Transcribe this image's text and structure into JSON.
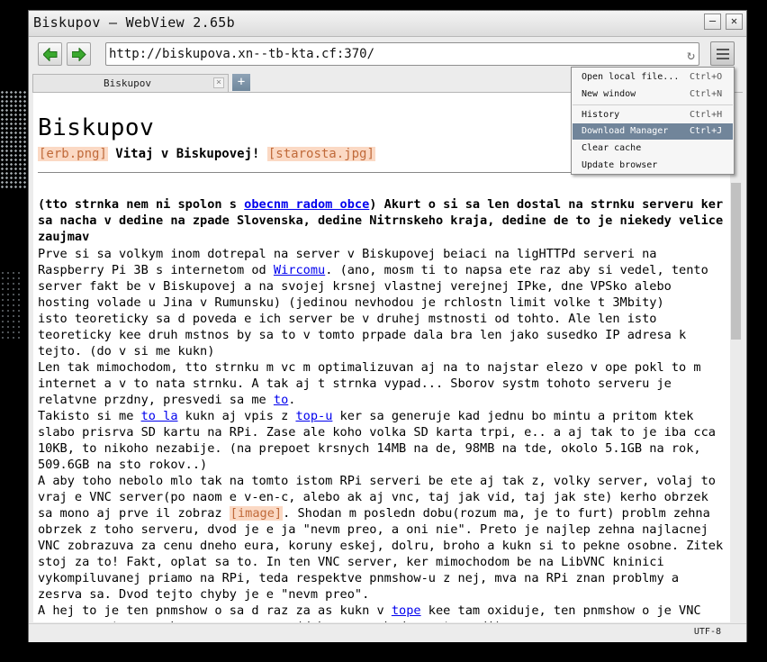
{
  "window": {
    "title": "Biskupov – WebView 2.65b"
  },
  "toolbar": {
    "url": "http://biskupova.xn--tb-kta.cf:370/"
  },
  "tabs": [
    {
      "label": "Biskupov"
    }
  ],
  "menu": {
    "items": [
      {
        "label": "Open local file...",
        "shortcut": "Ctrl+O"
      },
      {
        "label": "New window",
        "shortcut": "Ctrl+N"
      },
      {
        "label": "History",
        "shortcut": "Ctrl+H"
      },
      {
        "label": "Download Manager",
        "shortcut": "Ctrl+J"
      },
      {
        "label": "Clear cache",
        "shortcut": ""
      },
      {
        "label": "Update browser",
        "shortcut": ""
      }
    ]
  },
  "page": {
    "heading": "Biskupov",
    "img_erb": "[erb.png]",
    "welcome": " Vitaj v Biskupovej! ",
    "img_starosta": "[starosta.jpg]",
    "lead": {
      "t1": "(tto strnka nem ni spolon s ",
      "link": "obecnm radom obce",
      "t2": ") Akurt o si sa len dostal na strnku serveru ker sa nacha v dedine na zpade Slovenska, dedine Nitrnskeho kraja, dedine de to je niekedy velice zaujmav"
    },
    "p1": {
      "t1": "Prve si sa volkym inom dotrepal na server v Biskupovej beiaci na ligHTTPd serveri na Raspberry Pi 3B s internetom od ",
      "link": "Wircomu",
      "t2": ". (ano, mosm ti to napsa ete raz aby si vedel, tento server fakt be v Biskupovej a na svojej krsnej vlastnej verejnej IPke, dne VPSko alebo hosting volade u Jina v Rumunsku) (jedinou nevhodou je rchlostn limit volke t 3Mbity)"
    },
    "p2": "isto teoreticky sa d poveda e ich server be v druhej mstnosti od tohto. Ale len isto teoreticky kee druh mstnos by sa to v tomto prpade dala bra len jako susedko IP adresa k tejto. (do v si me kukn)",
    "p3": {
      "t1": "Len tak mimochodom, tto strnku m vc m optimalizuvan aj na to najstar elezo v ope pokl to m internet a v to nata strnku. A tak aj t strnka vypad... Sborov systm tohoto serveru je relatvne przdny, presvedi sa me ",
      "link": "to",
      "t2": "."
    },
    "p4": {
      "t1": "Takisto si me ",
      "link1": "to la",
      "t2": " kukn aj vpis z ",
      "link2": "top-u",
      "t3": " ker sa generuje kad jednu bo mintu a pritom ktek slabo prisrva SD kartu na RPi. Zase ale koho volka SD karta trpi, e.. a aj tak to je iba cca 10KB, to nikoho nezabije. (na prepoet krsnych 14MB na de, 98MB na tde, okolo 5.1GB na rok, 509.6GB na sto rokov..)"
    },
    "p5": {
      "t1": "A aby toho nebolo mlo tak na tomto istom RPi serveri be ete aj tak z, volky server, volaj to vraj e VNC server(po naom e v-en-c, alebo ak aj vnc, taj jak vid, taj jak ste) kerho obrzek sa mono aj prve il zobraz ",
      "img": "[image]",
      "t2": ". Shodan m posledn dobu(rozum ma, je to furt) problm zehna obrzek z toho serveru, dvod je e ja \"nevm preo, a oni nie\". Preto je najlep zehna najlacnej VNC zobrazuva za cenu dneho eura, koruny eskej, dolru, broho a kukn si to pekne osobne. Zitek stoj za to! Fakt, oplat sa to. In ten VNC server, ker mimochodom be na LibVNC kninici vykompiluvanej priamo na RPi, teda respektve pnmshow-u z nej, mva na RPi znan problmy a zesrva sa. Dvod tejto chyby je e \"nevm preo\"."
    },
    "p6": {
      "t1": "A hej to je ten pnmshow o sa d raz za as kukn v ",
      "link": "tope",
      "t2": " kee tam oxiduje, ten pnmshow o je VNC serverom, ten pnmshow o sa zesrva. (dobre, u nebudem s tm ondi)"
    }
  },
  "status": {
    "encoding": "UTF-8"
  },
  "colors": {
    "selection": "#71859a",
    "link": "#0000ee",
    "placeholder_bg": "#fbd9c4",
    "nav_arrow": "#3aa82e"
  }
}
